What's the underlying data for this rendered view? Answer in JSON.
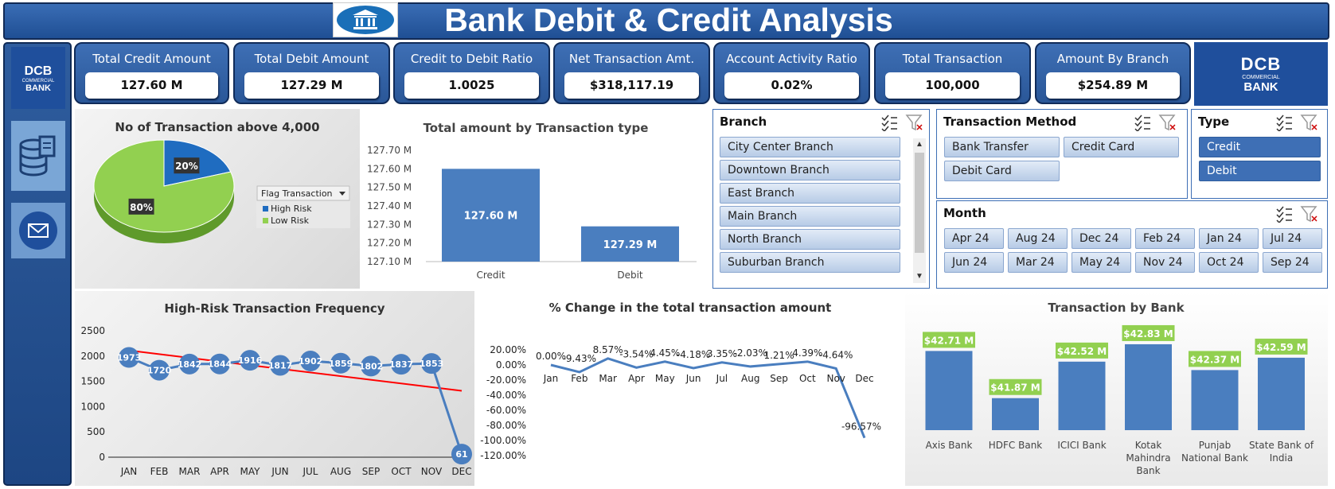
{
  "header": {
    "title": "Bank Debit & Credit Analysis"
  },
  "sidebar": {
    "logo_lines": [
      "DCB",
      "COMMERCIAL",
      "BANK"
    ]
  },
  "brand": {
    "lines": [
      "DCB",
      "COMMERCIAL",
      "BANK"
    ]
  },
  "kpis": [
    {
      "label": "Total Credit Amount",
      "value": "127.60 M"
    },
    {
      "label": "Total Debit Amount",
      "value": "127.29 M"
    },
    {
      "label": "Credit to Debit Ratio",
      "value": "1.0025"
    },
    {
      "label": "Net Transaction Amt.",
      "value": "$318,117.19"
    },
    {
      "label": "Account Activity Ratio",
      "value": "0.02%"
    },
    {
      "label": "Total Transaction",
      "value": "100,000"
    },
    {
      "label": "Amount By Branch",
      "value": "$254.89 M"
    }
  ],
  "pie": {
    "title": "No of Transaction above 4,000",
    "legend_title": "Flag Transaction",
    "legend": [
      "High Risk",
      "Low Risk"
    ],
    "labels": [
      "20%",
      "80%"
    ]
  },
  "slicers": {
    "branch": {
      "title": "Branch",
      "items": [
        "City Center Branch",
        "Downtown Branch",
        "East Branch",
        "Main Branch",
        "North Branch",
        "Suburban Branch"
      ]
    },
    "method": {
      "title": "Transaction Method",
      "items": [
        "Bank Transfer",
        "Credit Card",
        "Debit Card"
      ]
    },
    "type": {
      "title": "Type",
      "items": [
        "Credit",
        "Debit"
      ]
    },
    "month": {
      "title": "Month",
      "items": [
        "Apr 24",
        "Aug 24",
        "Dec 24",
        "Feb 24",
        "Jan 24",
        "Jul 24",
        "Jun 24",
        "Mar 24",
        "May 24",
        "Nov 24",
        "Oct 24",
        "Sep 24"
      ]
    }
  },
  "colors": {
    "accent": "#3e6fb5",
    "high_risk": "#1f6cc0",
    "low_risk": "#92d050",
    "trend": "#ff0000",
    "label_bg": "#92d050"
  },
  "chart_data": [
    {
      "type": "pie",
      "title": "No of Transaction above 4,000",
      "categories": [
        "High Risk",
        "Low Risk"
      ],
      "values": [
        20,
        80
      ],
      "legend_title": "Flag Transaction",
      "legend_position": "right"
    },
    {
      "type": "bar",
      "title": "Total amount by Transaction type",
      "categories": [
        "Credit",
        "Debit"
      ],
      "values": [
        127.6,
        127.29
      ],
      "value_labels": [
        "127.60  M",
        "127.29  M"
      ],
      "yticks": [
        "127.10 M",
        "127.20 M",
        "127.30 M",
        "127.40 M",
        "127.50 M",
        "127.60 M",
        "127.70 M"
      ],
      "ylim": [
        127.1,
        127.7
      ]
    },
    {
      "type": "line",
      "title": "High-Risk Transaction Frequency",
      "categories": [
        "JAN",
        "FEB",
        "MAR",
        "APR",
        "MAY",
        "JUN",
        "JUL",
        "AUG",
        "SEP",
        "OCT",
        "NOV",
        "DEC"
      ],
      "values": [
        1973,
        1720,
        1842,
        1844,
        1916,
        1817,
        1902,
        1859,
        1802,
        1837,
        1853,
        61
      ],
      "yticks": [
        "0",
        "500",
        "1000",
        "1500",
        "2000",
        "2500"
      ],
      "ylim": [
        0,
        2500
      ],
      "trendline": [
        2110,
        1313
      ]
    },
    {
      "type": "line",
      "title": "% Change in the total transaction amount",
      "categories": [
        "Jan",
        "Feb",
        "Mar",
        "Apr",
        "May",
        "Jun",
        "Jul",
        "Aug",
        "Sep",
        "Oct",
        "Nov",
        "Dec"
      ],
      "values": [
        0.0,
        -9.43,
        8.57,
        -3.54,
        4.45,
        -4.18,
        3.35,
        -2.03,
        1.21,
        4.39,
        -4.64,
        -96.57
      ],
      "value_labels": [
        "0.00%",
        "-9.43%",
        "8.57%",
        "-3.54%",
        "4.45%",
        "-4.18%",
        "3.35%",
        "-2.03%",
        "1.21%",
        "4.39%",
        "-4.64%",
        "-96.57%"
      ],
      "yticks": [
        "20.00%",
        "0.00%",
        "-20.00%",
        "-40.00%",
        "-60.00%",
        "-80.00%",
        "-100.00%",
        "-120.00%"
      ],
      "ylim": [
        -120,
        20
      ]
    },
    {
      "type": "bar",
      "title": "Transaction by Bank",
      "categories": [
        "Axis Bank",
        "HDFC Bank",
        "ICICI Bank",
        "Kotak Mahindra Bank",
        "Punjab National Bank",
        "State Bank of India"
      ],
      "values": [
        42.71,
        41.87,
        42.52,
        42.83,
        42.37,
        42.59
      ],
      "value_labels": [
        "$42.71  M",
        "$41.87  M",
        "$42.52  M",
        "$42.83  M",
        "$42.37  M",
        "$42.59  M"
      ]
    }
  ]
}
